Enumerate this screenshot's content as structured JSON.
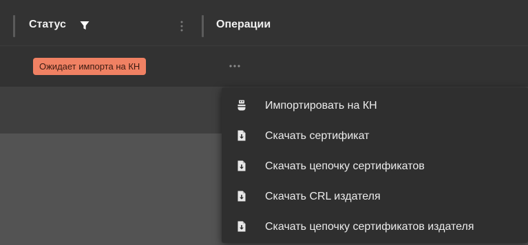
{
  "table": {
    "columns": [
      {
        "title": "Статус"
      },
      {
        "title": "Операции"
      }
    ],
    "rows": [
      {
        "status": "Ожидает импорта на КН"
      }
    ]
  },
  "colors": {
    "background": "#535353",
    "header_bg": "#333333",
    "menu_bg": "#2f2f2f",
    "badge_bg": "#f08163",
    "text": "#e6e6e6"
  },
  "icons": {
    "filter": "filter-icon",
    "column_menu": "kebab-vertical-icon",
    "row_operations": "more-horizontal-icon",
    "import": "usb-drive-icon",
    "download": "file-download-icon"
  },
  "menu": {
    "items": [
      {
        "label": "Импортировать на КН",
        "icon": "usb-drive-icon"
      },
      {
        "label": "Скачать сертификат",
        "icon": "file-download-icon"
      },
      {
        "label": "Скачать цепочку сертификатов",
        "icon": "file-download-icon"
      },
      {
        "label": "Скачать CRL издателя",
        "icon": "file-download-icon"
      },
      {
        "label": "Скачать цепочку сертификатов издателя",
        "icon": "file-download-icon"
      }
    ]
  }
}
